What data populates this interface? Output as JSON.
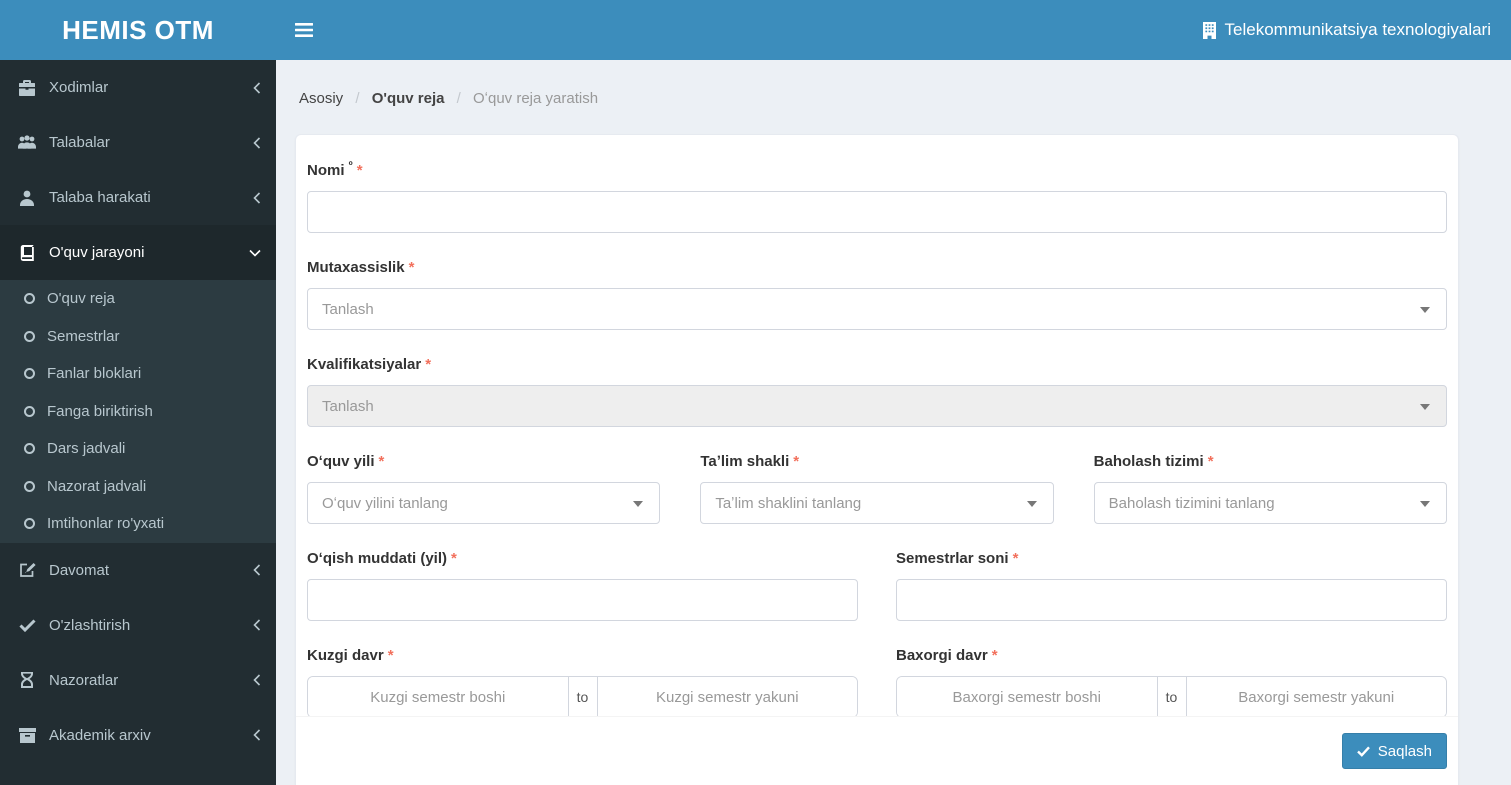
{
  "app": {
    "logo": "HEMIS OTM",
    "organization": "Telekommunikatsiya texnologiyalari"
  },
  "colors": {
    "navbar_blue": "#3c8dbc",
    "sidebar_dark": "#222d32",
    "sidebar_active": "#1e282c",
    "submenu_dark": "#2c3b41",
    "content_bg": "#ecf0f5",
    "required_red": "#f2705c",
    "input_border": "#d2d6de",
    "disabled_bg": "#eeeeee"
  },
  "sidebar": {
    "items": [
      {
        "label": "Xodimlar",
        "icon": "briefcase-icon",
        "chevron": "chevron-left-icon"
      },
      {
        "label": "Talabalar",
        "icon": "users-icon",
        "chevron": "chevron-left-icon"
      },
      {
        "label": "Talaba harakati",
        "icon": "user-icon",
        "chevron": "chevron-left-icon"
      },
      {
        "label": "O'quv jarayoni",
        "icon": "book-icon",
        "chevron": "chevron-down-icon",
        "active": true,
        "children": [
          "O'quv reja",
          "Semestrlar",
          "Fanlar bloklari",
          "Fanga biriktirish",
          "Dars jadvali",
          "Nazorat jadvali",
          "Imtihonlar ro'yxati"
        ]
      },
      {
        "label": "Davomat",
        "icon": "edit-icon",
        "chevron": "chevron-left-icon"
      },
      {
        "label": "O'zlashtirish",
        "icon": "check-icon",
        "chevron": "chevron-left-icon"
      },
      {
        "label": "Nazoratlar",
        "icon": "hourglass-icon",
        "chevron": "chevron-left-icon"
      },
      {
        "label": "Akademik arxiv",
        "icon": "archive-icon",
        "chevron": "chevron-left-icon"
      }
    ]
  },
  "breadcrumb": {
    "separator": "/",
    "items": [
      {
        "label": "Asosiy"
      },
      {
        "label": "O'quv reja"
      },
      {
        "label": "Oʻquv reja yaratish",
        "current": true
      }
    ]
  },
  "form": {
    "required_marker": "*",
    "fields": {
      "nomi": {
        "label": "Nomi",
        "suffix": "º",
        "value": ""
      },
      "mutaxassislik": {
        "label": "Mutaxassislik",
        "placeholder": "Tanlash"
      },
      "kvalifikatsiyalar": {
        "label": "Kvalifikatsiyalar",
        "placeholder": "Tanlash",
        "disabled": true
      },
      "oquv_yili": {
        "label": "Oʻquv yili",
        "placeholder": "Oʻquv yilini tanlang"
      },
      "talim_shakli": {
        "label": "Taʼlim shakli",
        "placeholder": "Taʼlim shaklini tanlang"
      },
      "baholash_tizimi": {
        "label": "Baholash tizimi",
        "placeholder": "Baholash tizimini tanlang"
      },
      "oqish_muddati": {
        "label": "Oʻqish muddati (yil)",
        "value": ""
      },
      "semestrlar_soni": {
        "label": "Semestrlar soni",
        "value": ""
      },
      "kuzgi_davr": {
        "label": "Kuzgi davr",
        "start_placeholder": "Kuzgi semestr boshi",
        "separator": "to",
        "end_placeholder": "Kuzgi semestr yakuni"
      },
      "baxorgi_davr": {
        "label": "Baxorgi davr",
        "start_placeholder": "Baxorgi semestr boshi",
        "separator": "to",
        "end_placeholder": "Baxorgi semestr yakuni"
      }
    },
    "save_button": "Saqlash"
  }
}
